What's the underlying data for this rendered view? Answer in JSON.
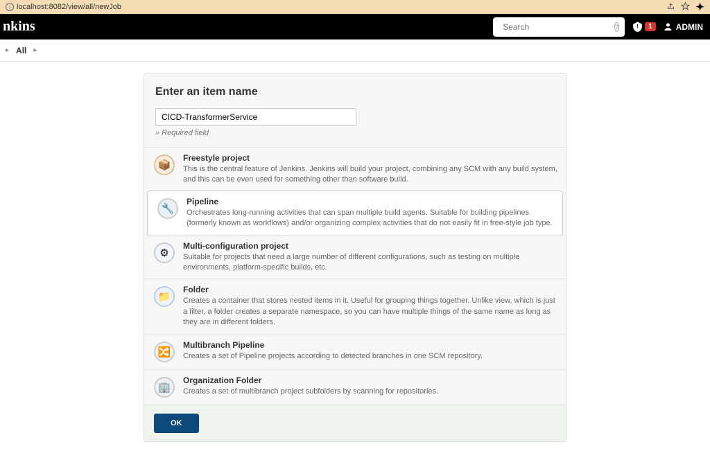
{
  "browser": {
    "url": "localhost:8082/view/all/newJob"
  },
  "header": {
    "logo": "nkins",
    "search_placeholder": "Search",
    "alert_count": "1",
    "admin_label": "ADMIN"
  },
  "breadcrumb": {
    "all": "All"
  },
  "card": {
    "title": "Enter an item name",
    "item_name_value": "CICD-TransformerService",
    "required_note": "» Required field",
    "ok_label": "OK"
  },
  "options": [
    {
      "title": "Freestyle project",
      "desc": "This is the central feature of Jenkins. Jenkins will build your project, combining any SCM with any build system, and this can be even used for something other than software build.",
      "selected": false,
      "icon": "freestyle"
    },
    {
      "title": "Pipeline",
      "desc": "Orchestrates long-running activities that can span multiple build agents. Suitable for building pipelines (formerly known as workflows) and/or organizing complex activities that do not easily fit in free-style job type.",
      "selected": true,
      "icon": "pipeline"
    },
    {
      "title": "Multi-configuration project",
      "desc": "Suitable for projects that need a large number of different configurations, such as testing on multiple environments, platform-specific builds, etc.",
      "selected": false,
      "icon": "multi"
    },
    {
      "title": "Folder",
      "desc": "Creates a container that stores nested items in it. Useful for grouping things together. Unlike view, which is just a filter, a folder creates a separate namespace, so you can have multiple things of the same name as long as they are in different folders.",
      "selected": false,
      "icon": "folder"
    },
    {
      "title": "Multibranch Pipeline",
      "desc": "Creates a set of Pipeline projects according to detected branches in one SCM repository.",
      "selected": false,
      "icon": "branch"
    },
    {
      "title": "Organization Folder",
      "desc": "Creates a set of multibranch project subfolders by scanning for repositories.",
      "selected": false,
      "icon": "org"
    }
  ]
}
